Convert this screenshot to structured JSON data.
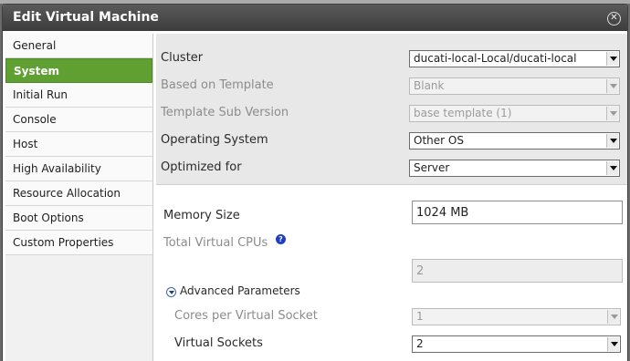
{
  "dialog": {
    "title": "Edit Virtual Machine",
    "close_glyph": "✕"
  },
  "sidebar": {
    "items": [
      {
        "label": "General"
      },
      {
        "label": "System",
        "active": true
      },
      {
        "label": "Initial Run"
      },
      {
        "label": "Console"
      },
      {
        "label": "Host"
      },
      {
        "label": "High Availability"
      },
      {
        "label": "Resource Allocation"
      },
      {
        "label": "Boot Options"
      },
      {
        "label": "Custom Properties"
      }
    ]
  },
  "general": {
    "cluster": {
      "label": "Cluster",
      "value": "ducati-local-Local/ducati-local"
    },
    "template": {
      "label": "Based on Template",
      "value": "Blank"
    },
    "template_version": {
      "label": "Template Sub Version",
      "value": "base template (1)"
    },
    "os": {
      "label": "Operating System",
      "value": "Other OS"
    },
    "optimized": {
      "label": "Optimized for",
      "value": "Server"
    }
  },
  "system": {
    "memory": {
      "label": "Memory Size",
      "value": "1024 MB"
    },
    "vcpus": {
      "label": "Total Virtual CPUs",
      "value": "2",
      "help_glyph": "?"
    },
    "advanced": {
      "label": "Advanced Parameters"
    },
    "cores": {
      "label": "Cores per Virtual Socket",
      "value": "1"
    },
    "sockets": {
      "label": "Virtual Sockets",
      "value": "2"
    }
  },
  "colors": {
    "active_item": "#60a033",
    "titlebar": "#4a4a4a",
    "help_icon": "#1f3fc2"
  },
  "icons": {
    "close": "close-icon",
    "help": "help-icon",
    "toggle": "expand-toggle-icon"
  }
}
